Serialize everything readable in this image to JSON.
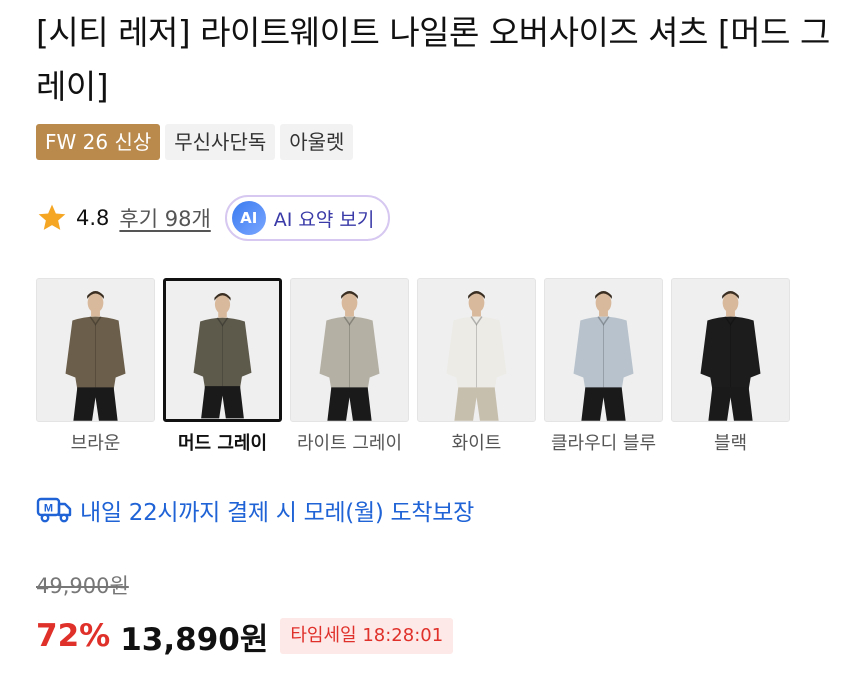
{
  "product": {
    "title": "[시티 레저] 라이트웨이트 나일론 오버사이즈 셔츠 [머드 그레이]"
  },
  "badges": [
    {
      "label": "FW 26 신상"
    },
    {
      "label": "무신사단독"
    },
    {
      "label": "아울렛"
    }
  ],
  "rating": {
    "value": "4.8",
    "review_text": "후기 98개",
    "ai_icon_text": "AI",
    "ai_label": "AI 요약 보기",
    "star_color": "#f5a623"
  },
  "colors": [
    {
      "label": "브라운",
      "shirt": "#6b5e4a",
      "pants": "#1a1a1a",
      "selected": false
    },
    {
      "label": "머드 그레이",
      "shirt": "#5d5a4c",
      "pants": "#1a1a1a",
      "selected": true
    },
    {
      "label": "라이트 그레이",
      "shirt": "#b4b0a4",
      "pants": "#1a1a1a",
      "selected": false
    },
    {
      "label": "화이트",
      "shirt": "#ecebe6",
      "pants": "#c7bfae",
      "selected": false
    },
    {
      "label": "클라우디 블루",
      "shirt": "#b7c2cc",
      "pants": "#1a1a1a",
      "selected": false
    },
    {
      "label": "블랙",
      "shirt": "#1c1c1c",
      "pants": "#1a1a1a",
      "selected": false
    }
  ],
  "delivery": {
    "text": "내일 22시까지 결제 시 모레(월) 도착보장",
    "icon_letter": "M",
    "color": "#1f63d6"
  },
  "price": {
    "original": "49,900원",
    "discount": "72%",
    "sale": "13,890원",
    "timesale": "타임세일 18:28:01",
    "discount_color": "#e0302a"
  }
}
